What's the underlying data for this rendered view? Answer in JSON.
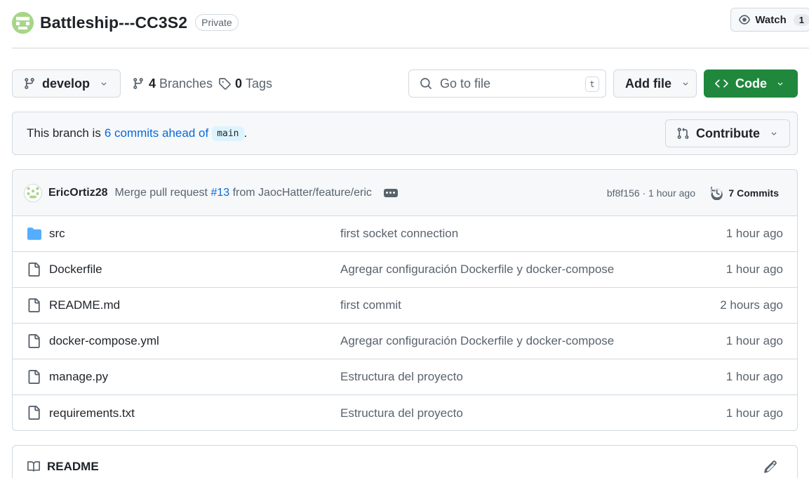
{
  "header": {
    "repo_name": "Battleship---CC3S2",
    "visibility": "Private",
    "watch_label": "Watch",
    "watch_count": "1"
  },
  "toolbar": {
    "branch_name": "develop",
    "branches_count": "4",
    "branches_label": "Branches",
    "tags_count": "0",
    "tags_label": "Tags",
    "search_placeholder": "Go to file",
    "search_shortcut": "t",
    "add_file_label": "Add file",
    "code_label": "Code"
  },
  "branch_info": {
    "prefix": "This branch is",
    "ahead_text": "6 commits ahead of",
    "base_branch": "main",
    "suffix": ".",
    "contribute_label": "Contribute"
  },
  "latest_commit": {
    "author": "EricOrtiz28",
    "message_prefix": "Merge pull request",
    "pr_number": "#13",
    "message_suffix": "from JaocHatter/feature/eric",
    "hash_time": "bf8f156 · 1 hour ago",
    "commits_label": "7 Commits"
  },
  "files": [
    {
      "name": "src",
      "type": "folder",
      "commit": "first socket connection",
      "time": "1 hour ago"
    },
    {
      "name": "Dockerfile",
      "type": "file",
      "commit": "Agregar configuración Dockerfile y docker-compose",
      "time": "1 hour ago"
    },
    {
      "name": "README.md",
      "type": "file",
      "commit": "first commit",
      "time": "2 hours ago"
    },
    {
      "name": "docker-compose.yml",
      "type": "file",
      "commit": "Agregar configuración Dockerfile y docker-compose",
      "time": "1 hour ago"
    },
    {
      "name": "manage.py",
      "type": "file",
      "commit": "Estructura del proyecto",
      "time": "1 hour ago"
    },
    {
      "name": "requirements.txt",
      "type": "file",
      "commit": "Estructura del proyecto",
      "time": "1 hour ago"
    }
  ],
  "readme": {
    "title": "README"
  },
  "colors": {
    "accent_link": "#0969da",
    "code_button": "#1f883d",
    "folder_icon": "#54aeff",
    "avatar_green": "#a8d58a"
  }
}
